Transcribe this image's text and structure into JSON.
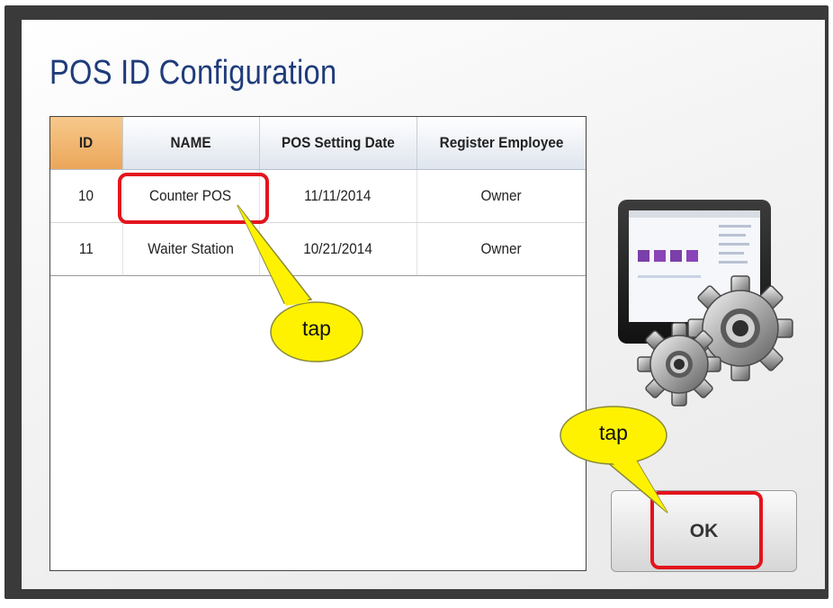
{
  "dialog": {
    "title": "POS ID Configuration"
  },
  "table": {
    "columns": [
      "ID",
      "NAME",
      "POS Setting Date",
      "Register Employee"
    ],
    "rows": [
      {
        "id": "10",
        "name": "Counter POS",
        "date": "11/11/2014",
        "employee": "Owner"
      },
      {
        "id": "11",
        "name": "Waiter Station",
        "date": "10/21/2014",
        "employee": "Owner"
      }
    ]
  },
  "ok_button": {
    "label": "OK"
  },
  "annotations": {
    "tap_1": "tap",
    "tap_2": "tap"
  },
  "colors": {
    "title": "#1f3c7a",
    "id_header": "#eba65a",
    "highlight": "#e3141d",
    "callout": "#fff200"
  },
  "illustration_icon": "pos-tablet-gears-icon"
}
